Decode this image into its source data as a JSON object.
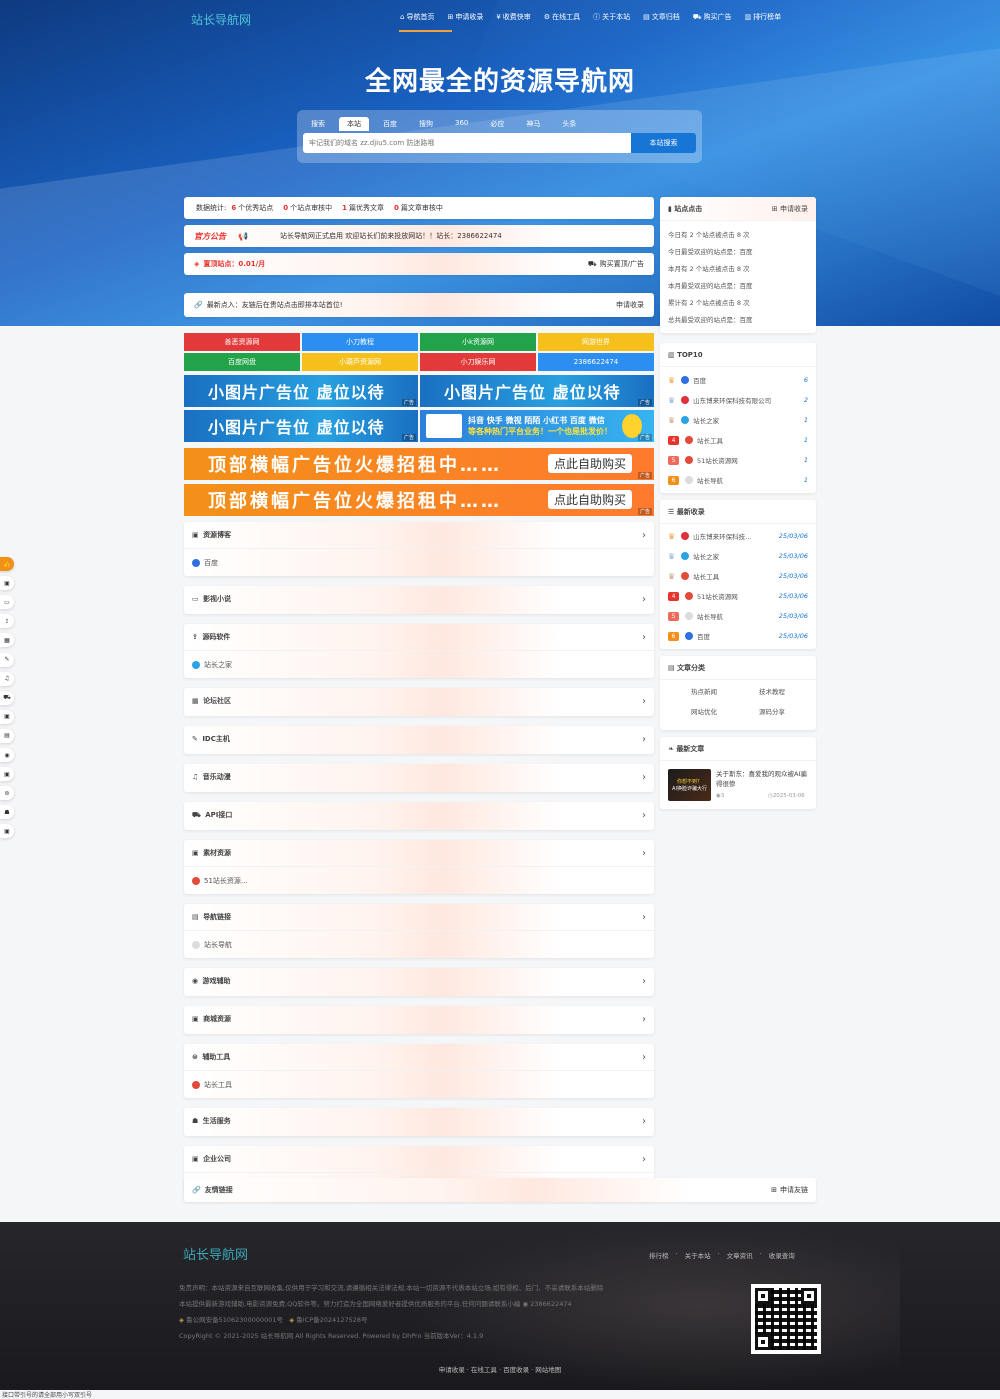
{
  "header": {
    "logo": "站长导航网",
    "nav": [
      {
        "icon": "home-icon",
        "glyph": "⌂",
        "label": "导航首页"
      },
      {
        "icon": "plus-box-icon",
        "glyph": "⊞",
        "label": "申请收录"
      },
      {
        "icon": "money-icon",
        "glyph": "¥",
        "label": "收费快审"
      },
      {
        "icon": "tools-icon",
        "glyph": "⚙",
        "label": "在线工具"
      },
      {
        "icon": "info-icon",
        "glyph": "ⓘ",
        "label": "关于本站"
      },
      {
        "icon": "folder-icon",
        "glyph": "▤",
        "label": "文章归档"
      },
      {
        "icon": "cart-icon",
        "glyph": "⛟",
        "label": "购买广告"
      },
      {
        "icon": "chart-icon",
        "glyph": "▥",
        "label": "排行榜单"
      }
    ]
  },
  "hero": {
    "title": "全网最全的资源导航网",
    "search_tabs": [
      "搜索",
      "本站",
      "百度",
      "搜狗",
      "360",
      "必应",
      "神马",
      "头条"
    ],
    "active_tab": "本站",
    "search_placeholder": "牢记我们的域名 zz.djiu5.com 防迷路哦",
    "search_button": "本站搜索"
  },
  "stats": {
    "prefix": "数据统计:",
    "excellent_count": "6",
    "excellent_label": "个优秀站点",
    "pending_count": "0",
    "pending_label": "个站点审核中",
    "article_count": "1",
    "article_label": "篇优秀文章",
    "article_pending_count": "0",
    "article_pending_label": "篇文章审核中"
  },
  "notice": {
    "badge": "官方公告",
    "text": "站长导航网正式启用 欢迎站长们前来投放网站！！站长：2386622474"
  },
  "pin": {
    "label": "置顶站点：0.01/月",
    "buy": "购买置顶/广告"
  },
  "latest": {
    "text": "最新点入：友链后在贵站点击即排本站首位!",
    "apply": "申请收录"
  },
  "quick_links": [
    {
      "label": "善恶资源网",
      "color": "#e23a3a"
    },
    {
      "label": "小刀教程",
      "color": "#2b8ef0"
    },
    {
      "label": "小k资源网",
      "color": "#22a34a"
    },
    {
      "label": "网游世界",
      "color": "#f6c01c"
    },
    {
      "label": "百度网盘",
      "color": "#22a34a"
    },
    {
      "label": "小葫芦资源网",
      "color": "#f6c01c"
    },
    {
      "label": "小刀娱乐网",
      "color": "#e23a3a"
    },
    {
      "label": "2386622474",
      "color": "#2b8ef0"
    }
  ],
  "ads": {
    "small": "小图片广告位 虚位以待",
    "tag": "广告",
    "promo_line1": "抖音 快手 微视 陌陌 小红书 百度 微信",
    "promo_line2": "等各种热门平台业务！一个也是批发价！",
    "banner": "顶部横幅广告位火爆招租中……",
    "banner_buy": "点此自助购买"
  },
  "categories": [
    {
      "icon": "book-icon",
      "glyph": "▣",
      "title": "资源博客",
      "item": "百度",
      "item_icon": "baidu-icon",
      "item_color": "#2f6fe0"
    },
    {
      "icon": "monitor-icon",
      "glyph": "▭",
      "title": "影视小说",
      "item": null
    },
    {
      "icon": "share-icon",
      "glyph": "⇪",
      "title": "源码软件",
      "item": "站长之家",
      "item_icon": "chinaz-icon",
      "item_color": "#2ca3e2"
    },
    {
      "icon": "forum-icon",
      "glyph": "▦",
      "title": "论坛社区",
      "item": null
    },
    {
      "icon": "wrench-icon",
      "glyph": "✎",
      "title": "IDC主机",
      "item": null
    },
    {
      "icon": "music-icon",
      "glyph": "♫",
      "title": "音乐动漫",
      "item": null
    },
    {
      "icon": "cart-icon",
      "glyph": "⛟",
      "title": "API接口",
      "item": null
    },
    {
      "icon": "material-icon",
      "glyph": "▣",
      "title": "素材资源",
      "item": "51站长资源...",
      "item_icon": "chrome-icon",
      "item_color": "#e34a3a"
    },
    {
      "icon": "link-icon",
      "glyph": "▤",
      "title": "导航链接",
      "item": "站长导航",
      "item_icon": "heart-icon",
      "item_color": "#dcdcdc"
    },
    {
      "icon": "game-icon",
      "glyph": "◉",
      "title": "游戏辅助",
      "item": null
    },
    {
      "icon": "shop-icon",
      "glyph": "▣",
      "title": "商城资源",
      "item": null
    },
    {
      "icon": "tool-icon",
      "glyph": "⊜",
      "title": "辅助工具",
      "item": "站长工具",
      "item_icon": "chrome-icon",
      "item_color": "#e34a3a"
    },
    {
      "icon": "life-icon",
      "glyph": "☗",
      "title": "生活服务",
      "item": null
    },
    {
      "icon": "company-icon",
      "glyph": "▣",
      "title": "企业公司",
      "item": "山东博来环...",
      "item_icon": "company-logo-icon",
      "item_color": "#e0303a"
    }
  ],
  "friend_links": {
    "title": "友情链接",
    "apply": "申请友链"
  },
  "sidebar": {
    "clicks": {
      "title": "站点点击",
      "apply": "申请收录",
      "lines": [
        "今日有 2 个站点被点击 8 次",
        "今日最受欢迎的站点是：百度",
        "本月有 2 个站点被点击 8 次",
        "本月最受欢迎的站点是：百度",
        "累计有 2 个站点被点击 8 次",
        "总共最受欢迎的站点是：百度"
      ]
    },
    "top10": {
      "title": "TOP10",
      "rows": [
        {
          "rank": "1",
          "name": "百度",
          "count": "6",
          "color": "#2f6fe0"
        },
        {
          "rank": "2",
          "name": "山东博来环保科技有限公司",
          "count": "2",
          "color": "#e0303a"
        },
        {
          "rank": "3",
          "name": "站长之家",
          "count": "1",
          "color": "#2ca3e2"
        },
        {
          "rank": "4",
          "name": "站长工具",
          "count": "1",
          "color": "#e34a3a"
        },
        {
          "rank": "5",
          "name": "51站长资源网",
          "count": "1",
          "color": "#e34a3a"
        },
        {
          "rank": "6",
          "name": "站长导航",
          "count": "1",
          "color": "#dcdcdc"
        }
      ]
    },
    "newest": {
      "title": "最新收录",
      "rows": [
        {
          "rank": "1",
          "name": "山东博来环保科技...",
          "date": "25/03/06",
          "color": "#e0303a"
        },
        {
          "rank": "2",
          "name": "站长之家",
          "date": "25/03/06",
          "color": "#2ca3e2"
        },
        {
          "rank": "3",
          "name": "站长工具",
          "date": "25/03/06",
          "color": "#e34a3a"
        },
        {
          "rank": "4",
          "name": "51站长资源网",
          "date": "25/03/06",
          "color": "#e34a3a"
        },
        {
          "rank": "5",
          "name": "站长导航",
          "date": "25/03/06",
          "color": "#dcdcdc"
        },
        {
          "rank": "6",
          "name": "百度",
          "date": "25/03/06",
          "color": "#2f6fe0"
        }
      ]
    },
    "article_cats": {
      "title": "文章分类",
      "items": [
        "热点新闻",
        "技术教程",
        "网站优化",
        "源码分享"
      ]
    },
    "new_articles": {
      "title": "最新文章",
      "thumb_line1": "你想不到？",
      "thumb_line2": "AI换脸诈骗大行",
      "article_title": "关于斯东：喜爱我的观众被AI骗得很惨",
      "views": "3",
      "date": "2025-03-06"
    }
  },
  "float_bar": [
    "thumb-icon",
    "book-icon",
    "monitor-icon",
    "share-icon",
    "forum-icon",
    "wrench-icon",
    "music-icon",
    "cart-icon",
    "material-icon",
    "link-icon",
    "game-icon",
    "shop-icon",
    "tool-icon",
    "life-icon",
    "company-icon"
  ],
  "footer": {
    "logo": "站长导航网",
    "links": [
      "排行榜",
      "关于本站",
      "文章资讯",
      "收录查询"
    ],
    "disclaimer": "免责声明：本站资源来自互联网收集,仅供用于学习和交流,请遵循相关法律法规,本站一切资源不代表本站立场,如有侵权、后门、不妥请联系本站删除",
    "notice": "本站提供最新游戏辅助,电影资源免费,QQ软件等。努力打造为全国网络爱好者提供优质服务的平台,任何问题请联系小编",
    "qq": "2386622474",
    "police": "鲁公网安备51062300000001号",
    "icp": "鲁ICP备2024127528号",
    "copyright": "CopyRight © 2021-2025 站长导航网 All Rights Reserved. Powered by DhPro 当前版本Ver：4.1.9",
    "bottom_links": [
      "申请收录",
      "在线工具",
      "百度收录",
      "网站地图"
    ]
  },
  "statusbar": "接口带引号的请全部用小写双引号"
}
